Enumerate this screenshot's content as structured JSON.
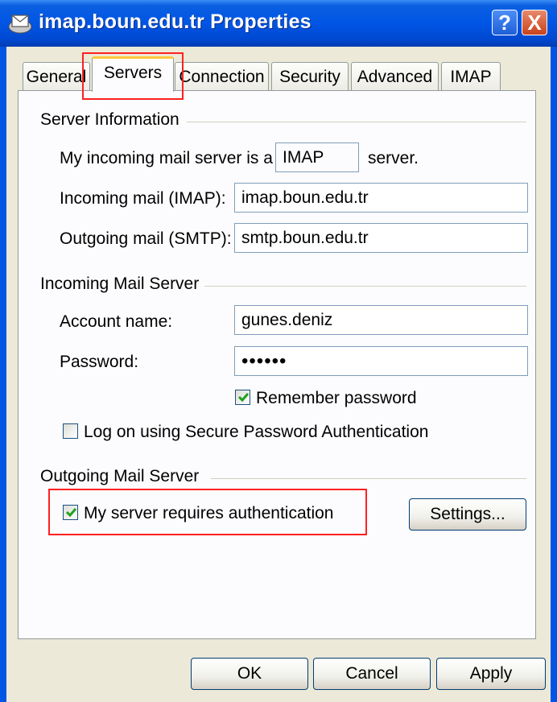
{
  "window": {
    "title": "imap.boun.edu.tr Properties",
    "help_label": "?",
    "close_label": "X"
  },
  "tabs": [
    {
      "label": "General"
    },
    {
      "label": "Servers",
      "active": true
    },
    {
      "label": "Connection"
    },
    {
      "label": "Security"
    },
    {
      "label": "Advanced"
    },
    {
      "label": "IMAP"
    }
  ],
  "server_info": {
    "group_label": "Server Information",
    "incoming_prefix": "My incoming mail server is a",
    "server_type": "IMAP",
    "incoming_suffix": "server.",
    "incoming_label": "Incoming mail (IMAP):",
    "incoming_value": "imap.boun.edu.tr",
    "outgoing_label": "Outgoing mail (SMTP):",
    "outgoing_value": "smtp.boun.edu.tr"
  },
  "incoming_server": {
    "group_label": "Incoming Mail Server",
    "account_label": "Account name:",
    "account_value": "gunes.deniz",
    "password_label": "Password:",
    "password_value": "••••••",
    "remember_label": "Remember password",
    "remember_checked": true,
    "spa_label": "Log on using Secure Password Authentication",
    "spa_checked": false
  },
  "outgoing_server": {
    "group_label": "Outgoing Mail Server",
    "auth_label": "My server requires authentication",
    "auth_checked": true,
    "settings_label": "Settings..."
  },
  "footer": {
    "ok_label": "OK",
    "cancel_label": "Cancel",
    "apply_label": "Apply"
  },
  "colors": {
    "titlebar": "#0055e5",
    "dialog_bg": "#ece9d8",
    "highlight": "#ff2020",
    "tab_accent": "#ffc83c",
    "check_green": "#21a121"
  }
}
